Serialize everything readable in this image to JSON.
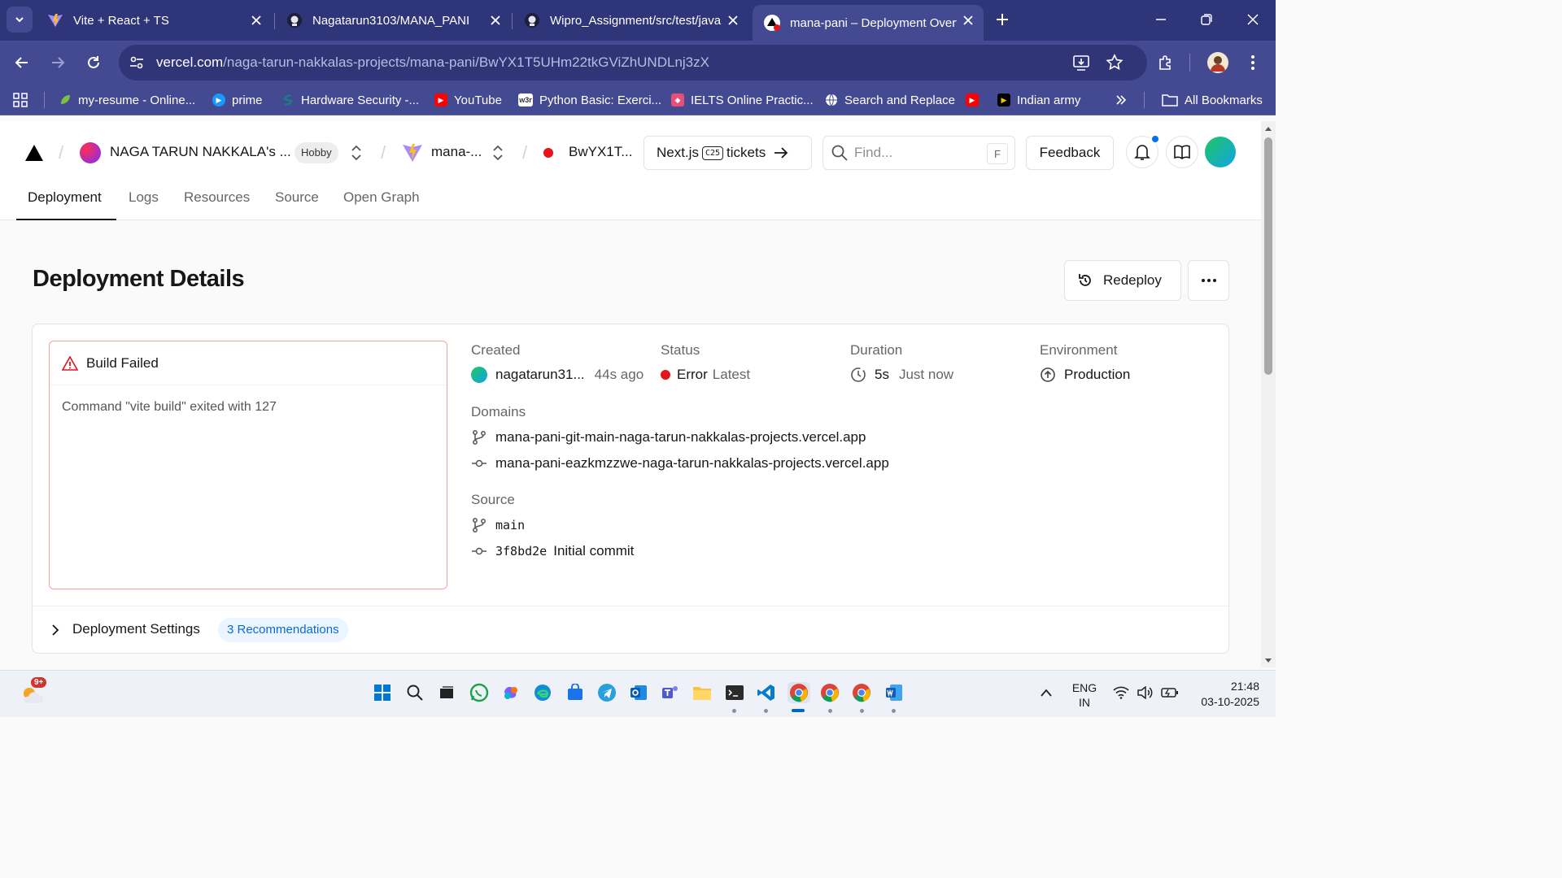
{
  "browser": {
    "tabs": [
      {
        "title": "Vite + React + TS",
        "active": false
      },
      {
        "title": "Nagatarun3103/MANA_PANI",
        "active": false
      },
      {
        "title": "Wipro_Assignment/src/test/java",
        "active": false
      },
      {
        "title": "mana-pani – Deployment Overv",
        "active": true
      }
    ],
    "url_host": "vercel.com",
    "url_path": "/naga-tarun-nakkalas-projects/mana-pani/BwYX1T5UHm22tkGViZhUNDLnj3zX",
    "bookmarks": [
      {
        "label": "my-resume - Online...",
        "icon": "leaf-icon"
      },
      {
        "label": "prime",
        "icon": "prime-video-icon"
      },
      {
        "label": "Hardware Security -...",
        "icon": "scribd-icon"
      },
      {
        "label": "YouTube",
        "icon": "youtube-icon"
      },
      {
        "label": "Python Basic: Exerci...",
        "icon": "w3r-icon"
      },
      {
        "label": "IELTS Online Practic...",
        "icon": "ielts-icon"
      },
      {
        "label": "Search and Replace",
        "icon": "globe-icon"
      },
      {
        "label": "",
        "icon": "youtube-icon"
      },
      {
        "label": "Indian army",
        "icon": "play-icon"
      }
    ],
    "all_bookmarks_label": "All Bookmarks",
    "w3r_text": "w3r"
  },
  "header": {
    "team_name": "NAGA TARUN NAKKALA's ...",
    "plan_badge": "Hobby",
    "project_name": "mana-...",
    "deployment_id": "BwYX1T...",
    "promo_prefix": "Next.js",
    "promo_badge": "C25",
    "promo_suffix": "tickets",
    "find_placeholder": "Find...",
    "find_shortcut": "F",
    "feedback_label": "Feedback"
  },
  "subtabs": [
    "Deployment",
    "Logs",
    "Resources",
    "Source",
    "Open Graph"
  ],
  "page": {
    "title": "Deployment Details",
    "redeploy_label": "Redeploy"
  },
  "build": {
    "status_title": "Build Failed",
    "message": "Command \"vite build\" exited with 127"
  },
  "details": {
    "created_label": "Created",
    "created_user": "nagatarun31...",
    "created_ago": "44s ago",
    "status_label": "Status",
    "status_value": "Error",
    "status_tag": "Latest",
    "duration_label": "Duration",
    "duration_value": "5s",
    "duration_when": "Just now",
    "environment_label": "Environment",
    "environment_value": "Production",
    "domains_label": "Domains",
    "domains": [
      "mana-pani-git-main-naga-tarun-nakkalas-projects.vercel.app",
      "mana-pani-eazkmzzwe-naga-tarun-nakkalas-projects.vercel.app"
    ],
    "source_label": "Source",
    "branch": "main",
    "commit_hash": "3f8bd2e",
    "commit_message": "Initial commit"
  },
  "settings": {
    "label": "Deployment Settings",
    "badge": "3 Recommendations"
  },
  "taskbar": {
    "weather_badge": "9+",
    "lang_line1": "ENG",
    "lang_line2": "IN",
    "time": "21:48",
    "date": "03-10-2025"
  },
  "colors": {
    "tabstrip": "#2e3579",
    "toolbar": "#434a91",
    "error_red": "#e5141b",
    "link_blue": "#0a6ad6"
  }
}
